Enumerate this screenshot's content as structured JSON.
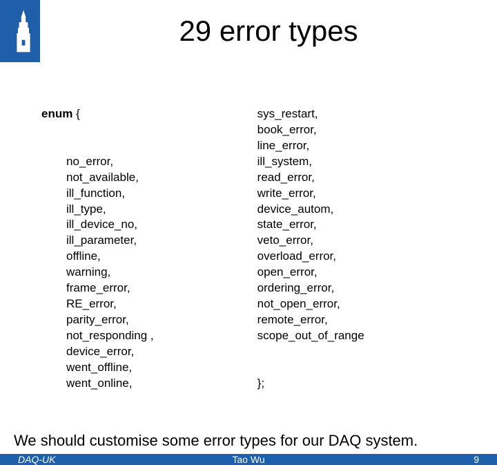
{
  "title": "29 error types",
  "enum": {
    "keyword": "enum",
    "open": "{",
    "left": [
      "no_error,",
      "not_available,",
      "ill_function,",
      "ill_type,",
      "ill_device_no,",
      "ill_parameter,",
      "offline,",
      "warning,",
      "frame_error,",
      "RE_error,",
      "parity_error,",
      "not_responding ,",
      "device_error,",
      "went_offline,",
      "went_online,"
    ],
    "right": [
      "sys_restart,",
      "book_error,",
      "line_error,",
      "ill_system,",
      "read_error,",
      "write_error,",
      "device_autom,",
      "state_error,",
      "veto_error,",
      "overload_error,",
      "open_error,",
      "ordering_error,",
      "not_open_error,",
      "remote_error,",
      "scope_out_of_range"
    ],
    "close": "};"
  },
  "note": "We should customise some error types for our DAQ system.",
  "footer": {
    "left": "DAQ-UK",
    "center": "Tao Wu",
    "right": "9"
  }
}
